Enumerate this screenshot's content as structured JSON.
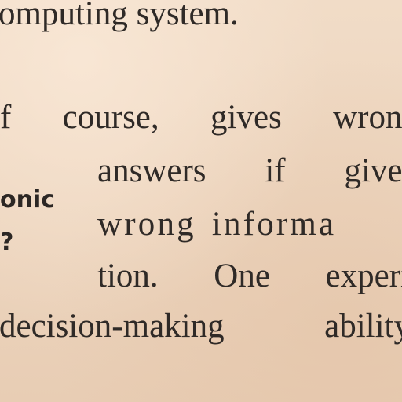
{
  "body_text": {
    "line1": "omputing system.",
    "line2": [
      "f",
      "course,",
      "gives",
      "wrong"
    ],
    "line3": [
      "answers",
      "if",
      "given"
    ],
    "line4": [
      "wrong",
      "informa"
    ],
    "line5": [
      "tion.",
      "One",
      "experi"
    ],
    "line6": [
      "decision-making",
      "ability"
    ]
  },
  "margin_note": {
    "line1": "onic",
    "line2": "?"
  },
  "colors": {
    "paper": "#efd9c3",
    "ink": "#2f2a27"
  }
}
